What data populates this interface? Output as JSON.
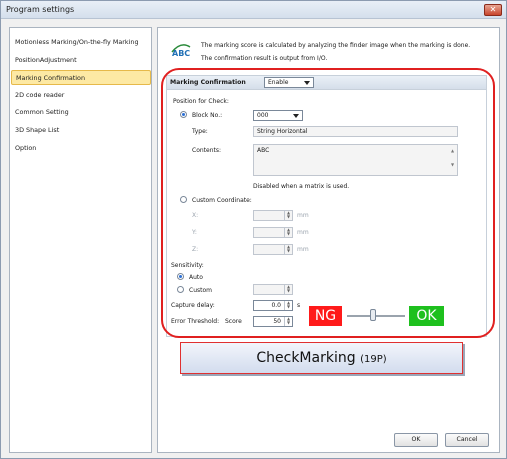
{
  "window": {
    "title": "Program settings",
    "close_label": "✕"
  },
  "sidebar": {
    "items": [
      {
        "label": "Motionless Marking/On-the-fly Marking"
      },
      {
        "label": "PositionAdjustment"
      },
      {
        "label": "Marking Confirmation"
      },
      {
        "label": "2D code reader"
      },
      {
        "label": "Common Setting"
      },
      {
        "label": "3D Shape List"
      },
      {
        "label": "Option"
      }
    ],
    "selected_index": 2
  },
  "info": {
    "icon_text": "ABC",
    "line1": "The marking score is calculated by analyzing the finder image when the marking is done.",
    "line2": "The confirmation result is output from I/O."
  },
  "marking_confirmation": {
    "label": "Marking Confirmation",
    "value": "Enable",
    "position_for_check_label": "Position for Check:",
    "block_no_label": "Block No.:",
    "block_no_value": "000",
    "type_label": "Type:",
    "type_value": "String Horizontal",
    "contents_label": "Contents:",
    "contents_value": "ABC",
    "disabled_note": "Disabled when a matrix is used.",
    "custom_coord_label": "Custom Coordinate:",
    "x_label": "X:",
    "y_label": "Y:",
    "z_label": "Z:",
    "unit_mm": "mm",
    "sensitivity_label": "Sensitivity:",
    "auto_label": "Auto",
    "custom_label": "Custom",
    "capture_delay_label": "Capture delay:",
    "capture_delay_value": "0.0",
    "capture_delay_unit": "s",
    "error_threshold_label": "Error Threshold:",
    "score_label": "Score",
    "score_value": "50"
  },
  "annotation": {
    "ng": "NG",
    "ok": "OK",
    "slider_level": 0.45,
    "callout_main": "CheckMarking",
    "callout_page": "(19P)"
  },
  "footer": {
    "ok_label": "OK",
    "cancel_label": "Cancel"
  },
  "colors": {
    "ng": "#ff1a1a",
    "ok": "#1ec01e",
    "frame": "#e02020",
    "selected": "#fde9a4"
  }
}
